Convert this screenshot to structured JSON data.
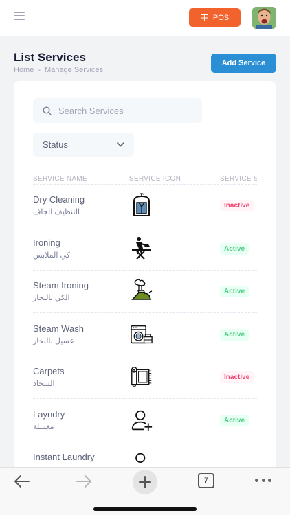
{
  "topbar": {
    "menu_icon": "hamburger-icon",
    "pos_label": "POS",
    "pos_icon": "grid-icon",
    "pos_color": "#f1622d"
  },
  "header": {
    "title": "List Services",
    "breadcrumb": [
      "Home",
      "-",
      "Manage Services"
    ],
    "add_button": "Add Service",
    "add_button_color": "#2b8fd6"
  },
  "filters": {
    "search_placeholder": "Search Services",
    "status_label": "Status"
  },
  "table": {
    "columns": [
      "SERVICE NAME",
      "SERVICE ICON",
      "SERVICE S"
    ],
    "rows": [
      {
        "name": "Dry Cleaning",
        "name_ar": "التنظيف الجاف",
        "icon": "garment-bag-icon",
        "status": "Inactive"
      },
      {
        "name": "Ironing",
        "name_ar": "كي الملابس",
        "icon": "person-ironing-icon",
        "status": "Active"
      },
      {
        "name": "Steam Ironing",
        "name_ar": "الكي بالبخار",
        "icon": "steam-iron-icon",
        "status": "Active"
      },
      {
        "name": "Steam Wash",
        "name_ar": "غسيل بالبخار",
        "icon": "washing-machine-icon",
        "status": "Active"
      },
      {
        "name": "Carpets",
        "name_ar": "السجاد",
        "icon": "carpet-roll-icon",
        "status": "Inactive"
      },
      {
        "name": "Layndry",
        "name_ar": "مغسلة",
        "icon": "add-user-icon",
        "status": "Active"
      },
      {
        "name": "Instant Laundry",
        "name_ar": "",
        "icon": "add-user-icon",
        "status": ""
      }
    ]
  },
  "browser_bar": {
    "tab_count": "7",
    "icons": [
      "back-arrow-icon",
      "forward-arrow-icon",
      "new-tab-icon",
      "tabs-icon",
      "more-icon"
    ]
  },
  "colors": {
    "inactive": "#f1416c",
    "active": "#50cd89"
  }
}
